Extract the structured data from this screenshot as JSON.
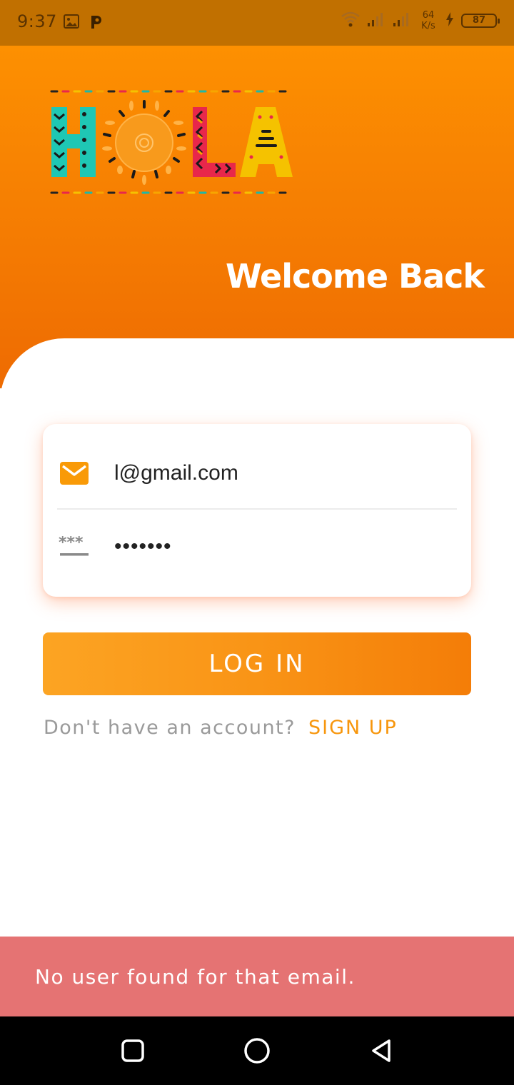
{
  "status_bar": {
    "time": "9:37",
    "net_speed_value": "64",
    "net_speed_unit": "K/s",
    "battery": "87",
    "icons": [
      "image-icon",
      "p-app-icon",
      "wifi-icon",
      "signal-icon",
      "signal-icon",
      "charging-icon",
      "battery-icon"
    ]
  },
  "header": {
    "logo_text": "HOLA",
    "welcome": "Welcome Back"
  },
  "form": {
    "email_value": "l@gmail.com",
    "email_icon": "mail-icon",
    "password_value": "•••••••",
    "password_icon": "password-icon"
  },
  "login_button": {
    "label": "LOG IN"
  },
  "signup": {
    "prompt": "Don't have an account?",
    "link": "SIGN UP"
  },
  "snackbar": {
    "message": "No user found for that email."
  },
  "navbar": {
    "buttons": [
      "recents-icon",
      "home-icon",
      "back-icon"
    ]
  },
  "colors": {
    "header_top": "#fd9001",
    "header_bottom": "#ee6b02",
    "accent": "#f7960c",
    "snackbar": "#e57373",
    "status_bar": "#c17000"
  }
}
